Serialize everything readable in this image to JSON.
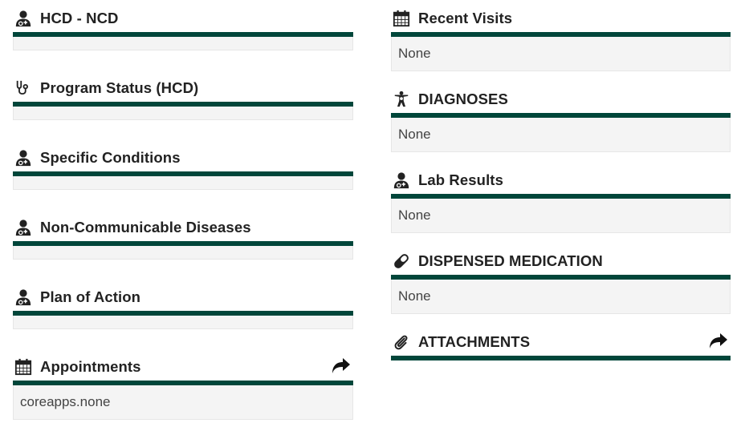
{
  "left_panels": [
    {
      "title": "HCD - NCD",
      "icon": "user-md-icon",
      "body": ""
    },
    {
      "title": "Program Status (HCD)",
      "icon": "stethoscope-icon",
      "body": ""
    },
    {
      "title": "Specific Conditions",
      "icon": "user-md-icon",
      "body": ""
    },
    {
      "title": "Non-Communicable Diseases",
      "icon": "user-md-icon",
      "body": ""
    },
    {
      "title": "Plan of Action",
      "icon": "user-md-icon",
      "body": ""
    },
    {
      "title": "Appointments",
      "icon": "calendar-icon",
      "body": "coreapps.none",
      "action_icon": "share-arrow-icon"
    }
  ],
  "right_panels": [
    {
      "title": "Recent Visits",
      "icon": "calendar-icon",
      "body": "None"
    },
    {
      "title": "DIAGNOSES",
      "icon": "body-diagnosis-icon",
      "body": "None"
    },
    {
      "title": "Lab Results",
      "icon": "user-md-icon",
      "body": "None"
    },
    {
      "title": "DISPENSED MEDICATION",
      "icon": "pill-icon",
      "body": "None"
    },
    {
      "title": "ATTACHMENTS",
      "icon": "paperclip-icon",
      "body": "",
      "action_icon": "share-arrow-icon"
    }
  ],
  "colors": {
    "accent": "#00463a",
    "panel_bg": "#f4f4f4"
  }
}
